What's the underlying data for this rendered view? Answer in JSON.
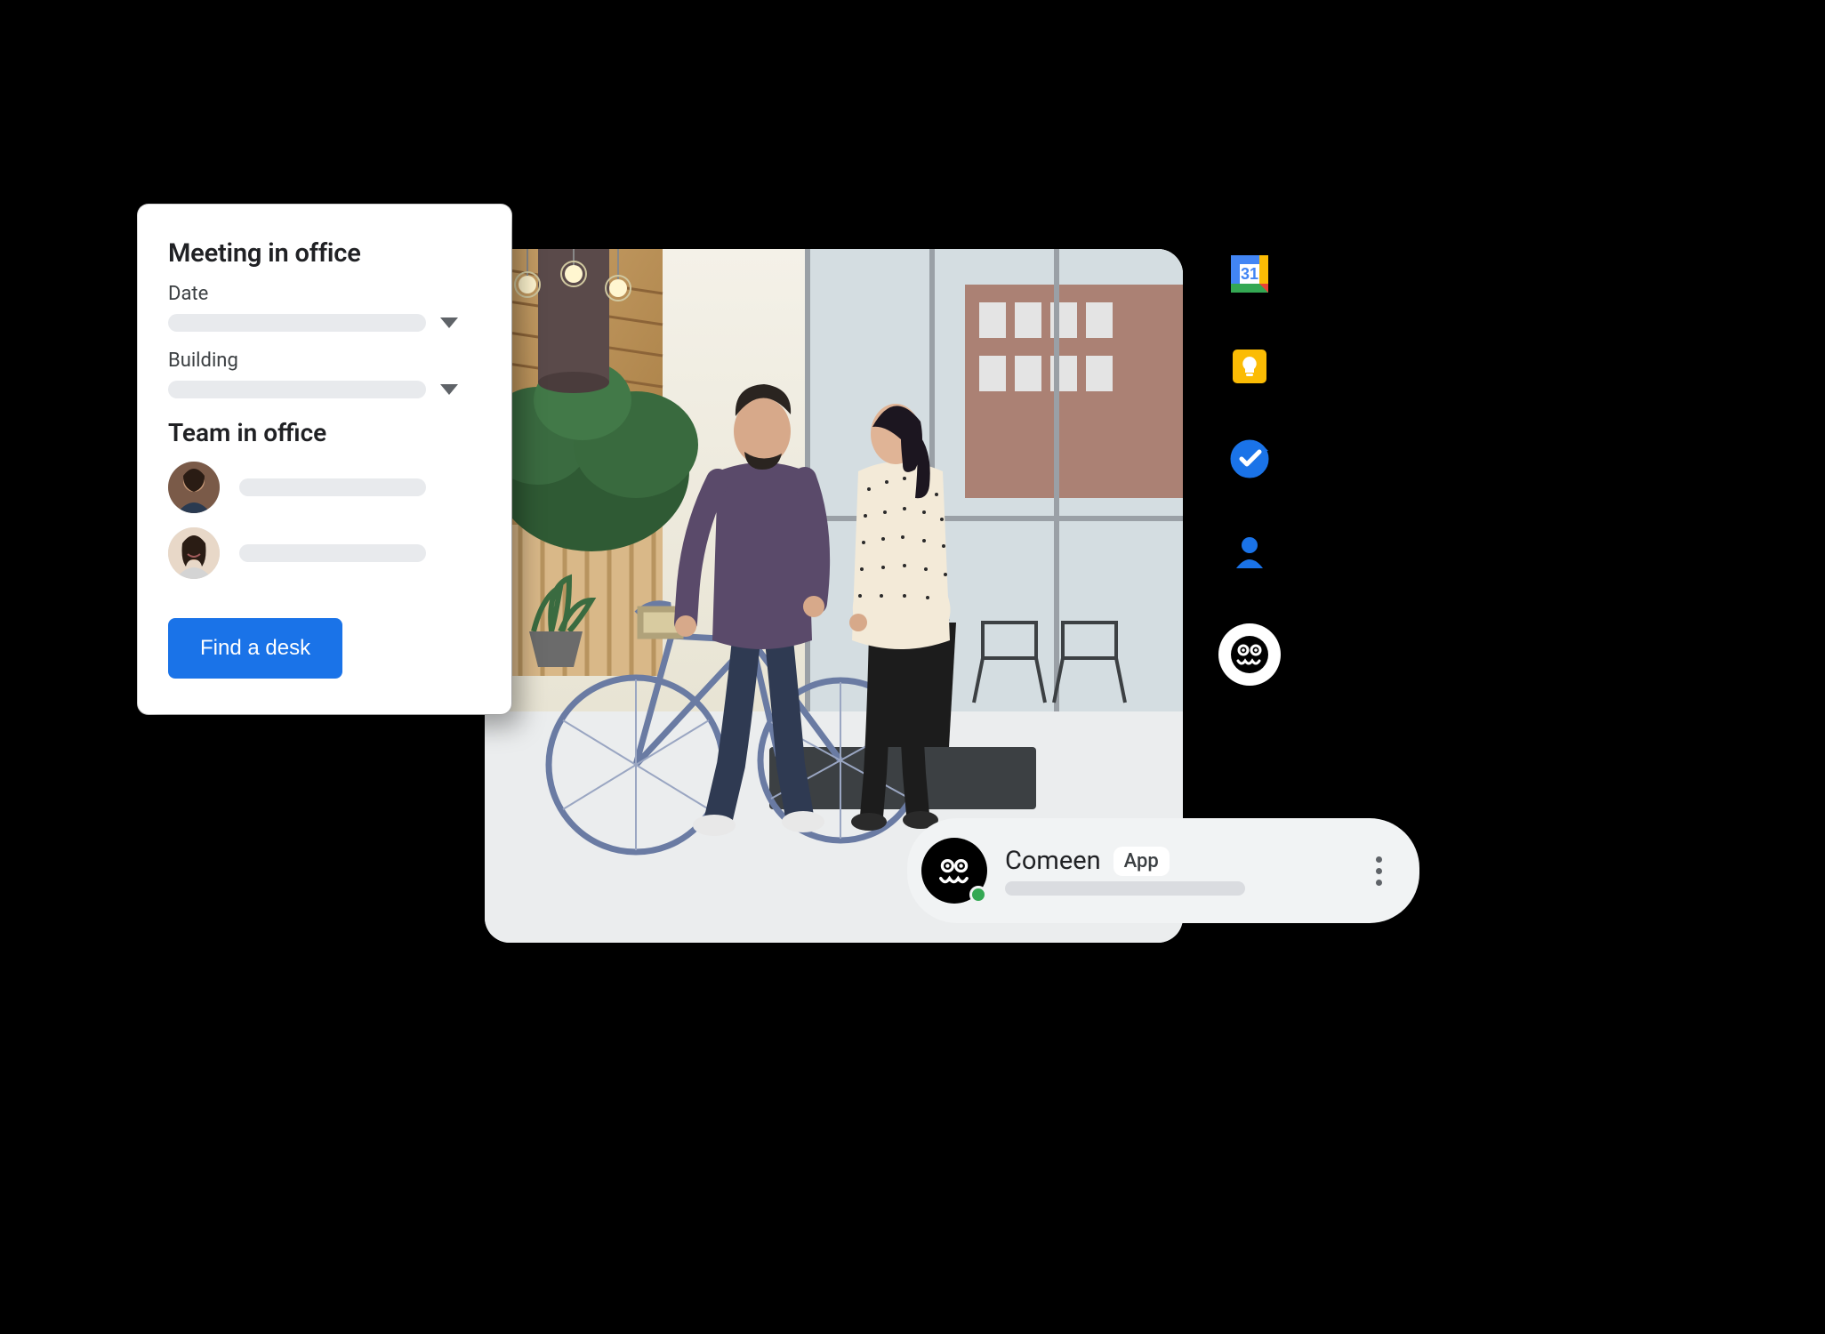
{
  "meeting_card": {
    "title": "Meeting in office",
    "date_label": "Date",
    "building_label": "Building",
    "team_heading": "Team in office",
    "button_label": "Find a desk",
    "team_members": [
      {
        "avatar": "person-1"
      },
      {
        "avatar": "person-2"
      }
    ]
  },
  "chat_chip": {
    "app_name": "Comeen",
    "badge": "App",
    "presence": "online"
  },
  "side_rail": {
    "items": [
      {
        "name": "calendar-icon",
        "label": "Calendar",
        "day": "31"
      },
      {
        "name": "keep-icon",
        "label": "Keep"
      },
      {
        "name": "tasks-icon",
        "label": "Tasks"
      },
      {
        "name": "contacts-icon",
        "label": "Contacts"
      },
      {
        "name": "comeen-icon",
        "label": "Comeen",
        "selected": true
      }
    ]
  },
  "colors": {
    "primary": "#1a73e8",
    "google_blue": "#4285f4",
    "google_red": "#ea4335",
    "google_yellow": "#fbbc04",
    "google_green": "#34a853"
  }
}
